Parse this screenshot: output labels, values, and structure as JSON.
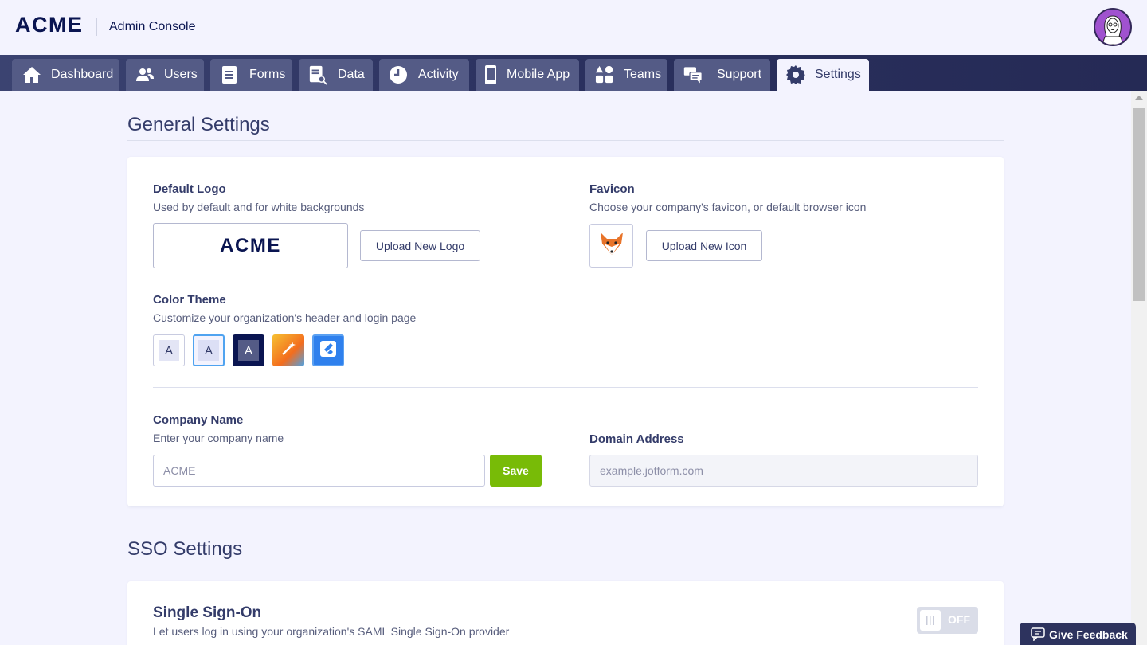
{
  "header": {
    "logo": "ACME",
    "title": "Admin Console",
    "avatar_icon": "user-avatar-icon"
  },
  "nav": {
    "tabs": [
      {
        "label": "Dashboard",
        "icon": "home-icon"
      },
      {
        "label": "Users",
        "icon": "users-icon"
      },
      {
        "label": "Forms",
        "icon": "forms-icon"
      },
      {
        "label": "Data",
        "icon": "data-icon"
      },
      {
        "label": "Activity",
        "icon": "clock-icon"
      },
      {
        "label": "Mobile App",
        "icon": "mobile-icon"
      },
      {
        "label": "Teams",
        "icon": "teams-icon"
      },
      {
        "label": "Support",
        "icon": "chat-icon"
      },
      {
        "label": "Settings",
        "icon": "gear-icon",
        "active": true
      }
    ]
  },
  "general": {
    "title": "General Settings",
    "default_logo": {
      "label": "Default Logo",
      "description": "Used by default and for white backgrounds",
      "preview": "ACME",
      "button": "Upload New Logo"
    },
    "favicon": {
      "label": "Favicon",
      "description": "Choose your company's favicon, or default browser icon",
      "button": "Upload New Icon",
      "icon": "fox-icon"
    },
    "color_theme": {
      "label": "Color Theme",
      "description": "Customize your organization's header and login page",
      "swatches": [
        {
          "letter": "A",
          "bg": "#ffffff",
          "inner": "#e3e5f5",
          "text": "#343c6a"
        },
        {
          "letter": "A",
          "bg": "#f3f3fe",
          "inner": "#dcdff5",
          "text": "#343c6a",
          "selected": true
        },
        {
          "letter": "A",
          "bg": "#0a1551",
          "inner": "#545b86",
          "text": "#ffffff"
        },
        {
          "icon": "magic-wand-icon",
          "bg": "#f38a1e"
        },
        {
          "icon": "jotform-icon",
          "bg": "#2f80ed"
        }
      ]
    },
    "company_name": {
      "label": "Company Name",
      "description": "Enter your company name",
      "placeholder": "ACME",
      "save": "Save"
    },
    "domain": {
      "label": "Domain Address",
      "placeholder": "example.jotform.com"
    }
  },
  "sso": {
    "title": "SSO Settings",
    "single_sign_on": {
      "label": "Single Sign-On",
      "description": "Let users log in using your organization's SAML Single Sign-On provider",
      "toggle": "OFF"
    }
  },
  "feedback": {
    "label": "Give Feedback",
    "icon": "feedback-icon"
  },
  "colors": {
    "accent_green": "#78bb07",
    "nav_dark": "#2a305e",
    "text": "#343c6a"
  }
}
